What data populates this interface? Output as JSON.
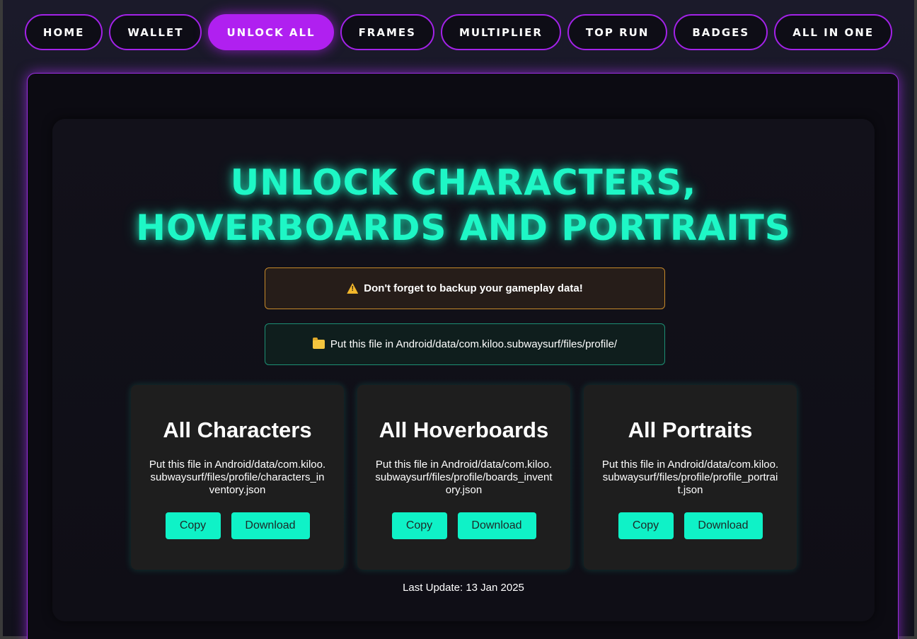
{
  "nav": {
    "items": [
      {
        "label": "Home",
        "active": false
      },
      {
        "label": "Wallet",
        "active": false
      },
      {
        "label": "Unlock All",
        "active": true
      },
      {
        "label": "Frames",
        "active": false
      },
      {
        "label": "Multiplier",
        "active": false
      },
      {
        "label": "Top Run",
        "active": false
      },
      {
        "label": "Badges",
        "active": false
      },
      {
        "label": "All In One",
        "active": false
      }
    ]
  },
  "main": {
    "title": "Unlock Characters, Hoverboards and Portraits",
    "warning": "Don't forget to backup your gameplay data!",
    "info": "Put this file in Android/data/com.kiloo.subwaysurf/files/profile/",
    "cards": [
      {
        "title": "All Characters",
        "text": "Put this file in Android/data/com.kiloo.subwaysurf/files/profile/characters_inventory.json",
        "copy_label": "Copy",
        "download_label": "Download"
      },
      {
        "title": "All Hoverboards",
        "text": "Put this file in Android/data/com.kiloo.subwaysurf/files/profile/boards_inventory.json",
        "copy_label": "Copy",
        "download_label": "Download"
      },
      {
        "title": "All Portraits",
        "text": "Put this file in Android/data/com.kiloo.subwaysurf/files/profile/profile_portrait.json",
        "copy_label": "Copy",
        "download_label": "Download"
      }
    ],
    "last_update": "Last Update: 13 Jan 2025"
  },
  "colors": {
    "accent_purple": "#b020f0",
    "accent_cyan": "#1ef7c6",
    "warning_border": "#c78a2a",
    "info_border": "#1c8f74"
  },
  "icons": {
    "warning": "warning-icon",
    "folder": "folder-icon"
  }
}
